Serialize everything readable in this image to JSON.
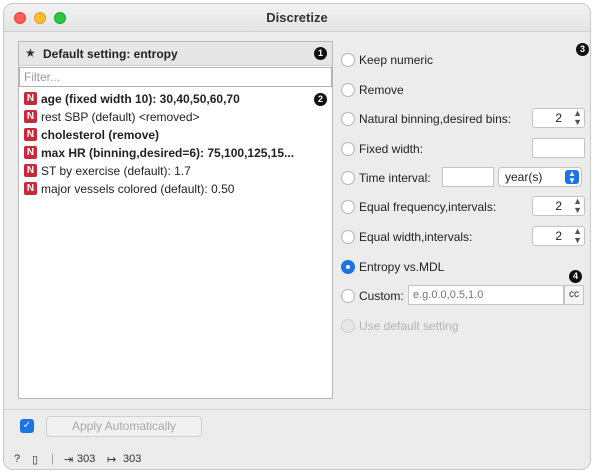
{
  "window": {
    "title": "Discretize"
  },
  "left": {
    "default_setting": "Default setting: entropy",
    "filter_placeholder": "Filter...",
    "variables": [
      {
        "badge": "N",
        "text": "age (fixed width 10): 30,40,50,60,70",
        "bold": true
      },
      {
        "badge": "N",
        "text": "rest SBP (default) <removed>",
        "bold": false
      },
      {
        "badge": "N",
        "text": "cholesterol (remove)",
        "bold": true
      },
      {
        "badge": "N",
        "text": "max HR (binning,desired=6): 75,100,125,15...",
        "bold": true
      },
      {
        "badge": "N",
        "text": "ST by exercise (default): 1.7",
        "bold": false
      },
      {
        "badge": "N",
        "text": "major vessels colored (default): 0.50",
        "bold": false
      }
    ]
  },
  "callouts": {
    "one": "1",
    "two": "2",
    "three": "3",
    "four": "4"
  },
  "options": {
    "keep_numeric": "Keep numeric",
    "remove": "Remove",
    "natural_binning": "Natural binning,desired bins:",
    "natural_binning_value": "2",
    "fixed_width": "Fixed width:",
    "time_interval": "Time interval:",
    "time_unit": "year(s)",
    "equal_frequency": "Equal frequency,intervals:",
    "equal_frequency_value": "2",
    "equal_width": "Equal width,intervals:",
    "equal_width_value": "2",
    "entropy_mdl": "Entropy vs.MDL",
    "custom": "Custom:",
    "custom_placeholder": "e.g.0.0,0.5,1.0",
    "custom_button": "cc",
    "use_default": "Use default setting",
    "selected": "entropy_mdl"
  },
  "footer": {
    "apply_automatically": "Apply Automatically",
    "apply_checked": true
  },
  "status": {
    "input_count": "303",
    "output_count": "303"
  }
}
